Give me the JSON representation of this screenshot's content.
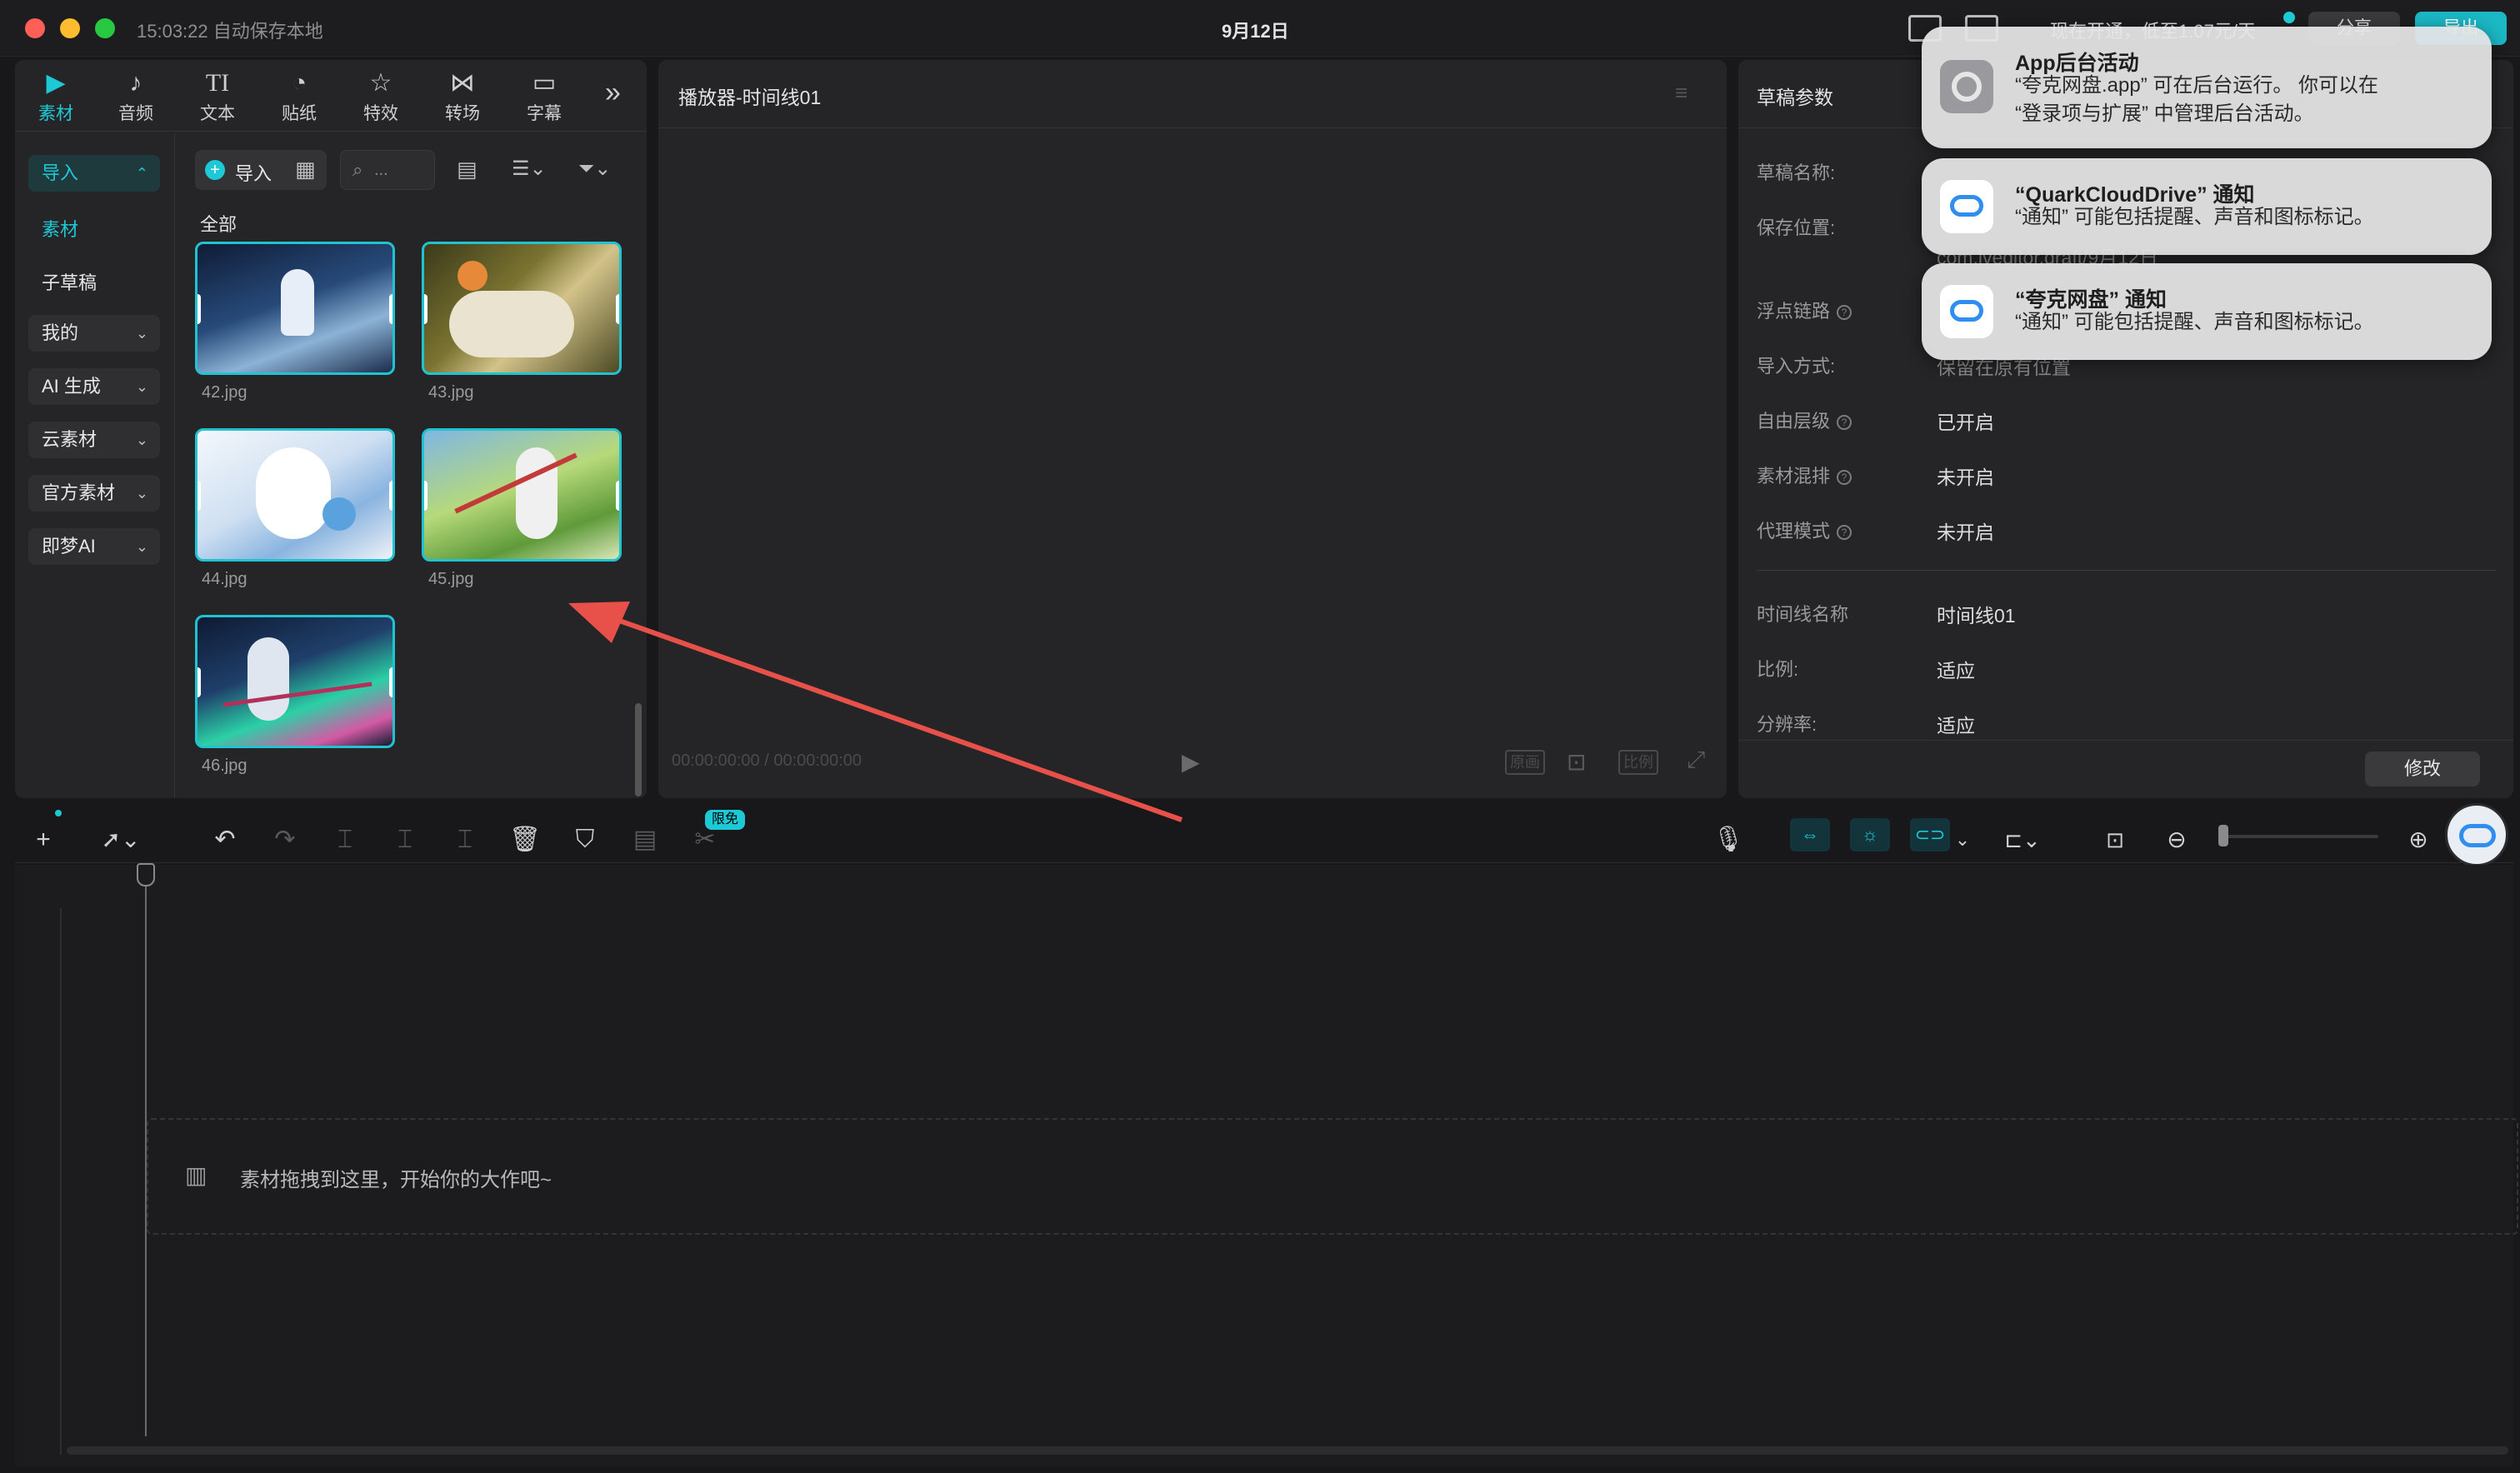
{
  "window": {
    "autosave": "15:03:22 自动保存本地",
    "title": "9月12日",
    "topbar_partial_text": "现在开通，低至1.07元/天",
    "share_label": "分享",
    "export_label": "导出"
  },
  "toolbar": {
    "tabs": [
      {
        "label": "素材",
        "icon": "media-icon"
      },
      {
        "label": "音频",
        "icon": "audio-icon"
      },
      {
        "label": "文本",
        "icon": "text-icon"
      },
      {
        "label": "贴纸",
        "icon": "sticker-icon"
      },
      {
        "label": "特效",
        "icon": "effects-icon"
      },
      {
        "label": "转场",
        "icon": "transition-icon"
      },
      {
        "label": "字幕",
        "icon": "caption-icon"
      }
    ],
    "more": "»"
  },
  "sidebar": {
    "import_label": "导入",
    "items": [
      {
        "label": "素材"
      },
      {
        "label": "子草稿"
      },
      {
        "label": "我的"
      },
      {
        "label": "AI 生成"
      },
      {
        "label": "云素材"
      },
      {
        "label": "官方素材"
      },
      {
        "label": "即梦AI"
      }
    ]
  },
  "media": {
    "import_button": "导入",
    "search_placeholder": "...",
    "section_label": "全部",
    "files": [
      {
        "name": "42.jpg"
      },
      {
        "name": "43.jpg"
      },
      {
        "name": "44.jpg"
      },
      {
        "name": "45.jpg"
      },
      {
        "name": "46.jpg"
      }
    ]
  },
  "player": {
    "title": "播放器-时间线01",
    "timecode": "00:00:00:00 / 00:00:00:00",
    "original_label": "原画",
    "ratio_label": "比例"
  },
  "params": {
    "title": "草稿参数",
    "rows": [
      {
        "label": "草稿名称:",
        "value": ""
      },
      {
        "label": "保存位置:",
        "value": "com.lveditor.draft/9月12日"
      },
      {
        "label": "浮点链路",
        "value": ""
      },
      {
        "label": "导入方式:",
        "value": "保留在原有位置"
      },
      {
        "label": "自由层级",
        "value": "已开启"
      },
      {
        "label": "素材混排",
        "value": "未开启"
      },
      {
        "label": "代理模式",
        "value": "未开启"
      }
    ],
    "timeline_rows": [
      {
        "label": "时间线名称",
        "value": "时间线01"
      },
      {
        "label": "比例:",
        "value": "适应"
      },
      {
        "label": "分辨率:",
        "value": "适应"
      }
    ],
    "modify_button": "修改"
  },
  "timeline": {
    "badge": "限免",
    "drop_hint": "素材拖拽到这里，开始你的大作吧~"
  },
  "notifications": [
    {
      "title": "App后台活动",
      "body_line1": "“夸克网盘.app” 可在后台运行。 你可以在",
      "body_line2": "“登录项与扩展” 中管理后台活动。"
    },
    {
      "title": "“QuarkCloudDrive” 通知",
      "body_line1": "“通知” 可能包括提醒、声音和图标标记。",
      "body_line2": ""
    },
    {
      "title": "“夸克网盘” 通知",
      "body_line1": "“通知” 可能包括提醒、声音和图标标记。",
      "body_line2": ""
    }
  ],
  "colors": {
    "accent": "#1ec9d6",
    "annotation_arrow": "#e8514a"
  }
}
